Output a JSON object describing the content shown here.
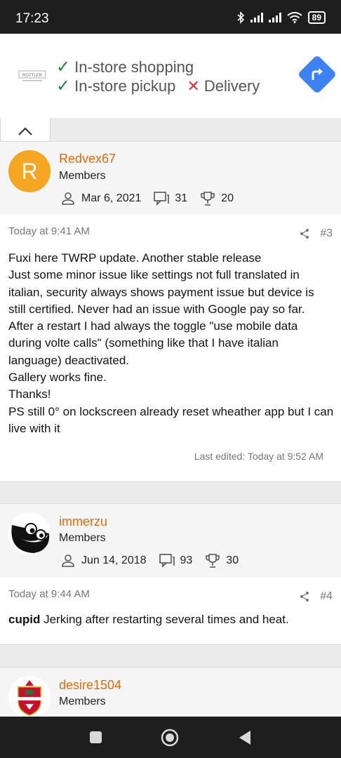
{
  "status_bar": {
    "time": "17:23",
    "battery": "89"
  },
  "ad": {
    "brand_text": "ROTTLER",
    "line1": "In-store shopping",
    "line2_check": "In-store pickup",
    "line2_cross": "Delivery"
  },
  "posts": [
    {
      "username": "Redvex67",
      "avatar_letter": "R",
      "role": "Members",
      "joined": "Mar 6, 2021",
      "messages": "31",
      "reactions": "20",
      "date": "Today at 9:41 AM",
      "number": "#3",
      "body": [
        "Fuxi here TWRP update. Another stable release",
        "Just some minor issue like settings not full translated in italian, security always shows payment issue but device is still certified. Never had an issue with Google pay so far.",
        "After a restart I had always the toggle \"use mobile data during volte calls\" (something like that I have italian language) deactivated.",
        "Gallery works fine.",
        "Thanks!",
        "PS still 0° on lockscreen already reset wheather app but I can live with it"
      ],
      "edited": "Last edited: Today at 9:52 AM"
    },
    {
      "username": "immerzu",
      "role": "Members",
      "joined": "Jun 14, 2018",
      "messages": "93",
      "reactions": "30",
      "date": "Today at 9:44 AM",
      "number": "#4",
      "mention": "cupid",
      "body_text": "Jerking after restarting several times and heat."
    },
    {
      "username": "desire1504",
      "role": "Members"
    }
  ],
  "colors": {
    "username": "#e36b0c",
    "avatar_r": "#f5a623"
  }
}
